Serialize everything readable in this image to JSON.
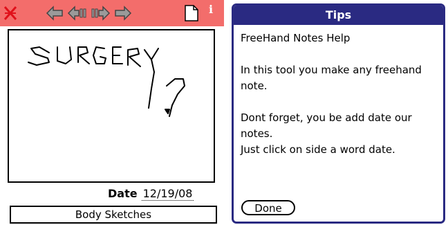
{
  "app": {
    "toolbar": {
      "icons": [
        "close-x-icon",
        "first-page-arrow-icon",
        "previous-page-arrow-icon",
        "next-page-arrow-icon",
        "last-page-arrow-icon",
        "new-page-icon",
        "info-icon"
      ],
      "info_label": "i",
      "toolbar_color": "#f36d6b"
    },
    "canvas": {
      "handwriting": "SURGERY ?"
    },
    "date": {
      "label": "Date",
      "value": "12/19/08"
    },
    "notebook_name": "Body Sketches"
  },
  "tips_dialog": {
    "title": "Tips",
    "title_bar_color": "#2a2a82",
    "heading": "FreeHand Notes Help",
    "paragraph1": "In this tool you make any freehand note.",
    "paragraph2_line1": "Dont forget, you be add date our notes.",
    "paragraph2_line2": "Just click on side a word date.",
    "done_label": "Done"
  }
}
